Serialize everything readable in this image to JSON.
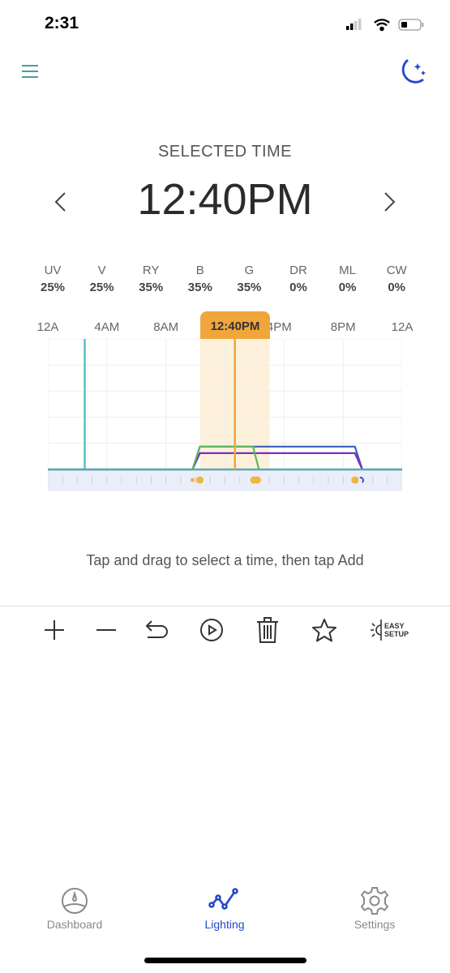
{
  "status_bar": {
    "time": "2:31",
    "signal_bars": 2,
    "battery_percent": 25
  },
  "header": {
    "menu_icon": "hamburger-icon",
    "mode_icon": "moon-stars-icon",
    "accent": "#4a9fa0",
    "moon_color": "#2448c8"
  },
  "selected": {
    "label": "SELECTED TIME",
    "time": "12:40PM"
  },
  "channels": [
    {
      "name": "UV",
      "value": "25%"
    },
    {
      "name": "V",
      "value": "25%"
    },
    {
      "name": "RY",
      "value": "35%"
    },
    {
      "name": "B",
      "value": "35%"
    },
    {
      "name": "G",
      "value": "35%"
    },
    {
      "name": "DR",
      "value": "0%"
    },
    {
      "name": "ML",
      "value": "0%"
    },
    {
      "name": "CW",
      "value": "0%"
    }
  ],
  "chart_data": {
    "type": "line",
    "x_unit": "hour of day",
    "xlim": [
      0,
      24
    ],
    "ylim": [
      0,
      200
    ],
    "tick_labels": [
      "12A",
      "4AM",
      "8AM",
      "12:40PM",
      "4PM",
      "8PM",
      "12A"
    ],
    "selected_hour": 12.67,
    "selected_label": "12:40PM",
    "now_marker_hour": 2.5,
    "grid": true,
    "series": [
      {
        "color": "#3a5fb8",
        "points": [
          [
            0,
            0
          ],
          [
            9.8,
            0
          ],
          [
            10.3,
            35
          ],
          [
            20.8,
            35
          ],
          [
            21.3,
            0
          ],
          [
            24,
            0
          ]
        ]
      },
      {
        "color": "#7a2fc0",
        "points": [
          [
            9.8,
            0
          ],
          [
            10.3,
            25
          ],
          [
            20.8,
            25
          ],
          [
            21.3,
            0
          ]
        ]
      },
      {
        "color": "#5cb85c",
        "points": [
          [
            9.8,
            0
          ],
          [
            10.3,
            35
          ],
          [
            13.9,
            35
          ],
          [
            14.3,
            0
          ]
        ]
      }
    ],
    "schedule_points": [
      9.8,
      10.3,
      13.9,
      14.3,
      20.8,
      21.3
    ]
  },
  "hint": "Tap and drag to select a time, then tap Add",
  "toolbar": {
    "easy_setup_line1": "EASY",
    "easy_setup_line2": "SETUP"
  },
  "nav": [
    {
      "label": "Dashboard",
      "icon": "gauge-icon"
    },
    {
      "label": "Lighting",
      "icon": "line-chart-icon",
      "active": true
    },
    {
      "label": "Settings",
      "icon": "gear-icon"
    }
  ]
}
